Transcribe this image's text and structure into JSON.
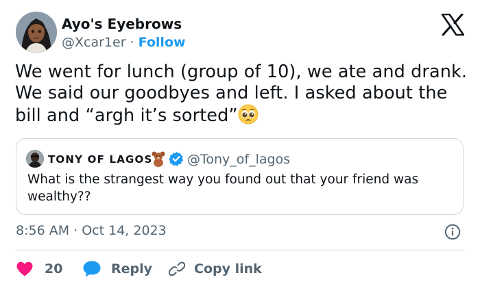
{
  "author": {
    "display_name": "Ayo's Eyebrows",
    "handle": "@Xcar1er",
    "separator": "·",
    "follow_label": "Follow"
  },
  "tweet": {
    "line1": "We went for lunch (group of 10), we ate and drank.",
    "line2": "We said our goodbyes and left. I asked about the",
    "line3": "bill and “argh it’s sorted”"
  },
  "quoted": {
    "display_name": "TONY OF LAGOS",
    "handle": "@Tony_of_lagos",
    "text": "What is the strangest way you found out that your friend was wealthy??"
  },
  "meta": {
    "timestamp": "8:56 AM · Oct 14, 2023"
  },
  "actions": {
    "likes_count": "20",
    "reply_label": "Reply",
    "copy_label": "Copy link"
  },
  "colors": {
    "accent": "#1d9bf0",
    "like": "#f91880",
    "text": "#0f1419",
    "secondary": "#536471",
    "border": "#cfd9de"
  },
  "icons": [
    "x-logo-icon",
    "verified-badge-icon",
    "teddy-bear-icon",
    "pleading-face-emoji-icon",
    "info-icon",
    "heart-icon",
    "reply-bubble-icon",
    "link-icon"
  ]
}
